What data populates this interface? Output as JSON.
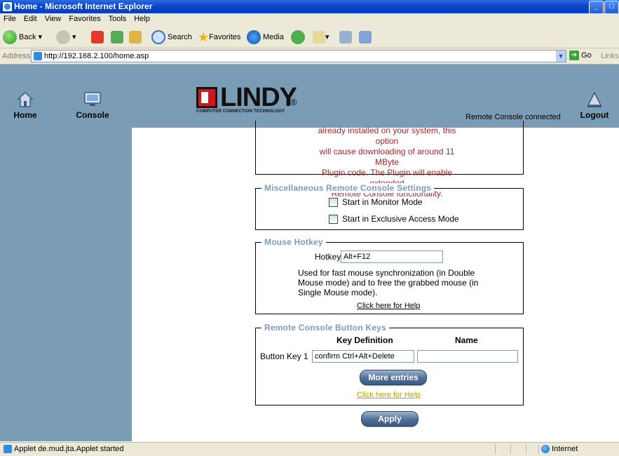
{
  "window": {
    "title": "Home - Microsoft Internet Explorer"
  },
  "menu": [
    "File",
    "Edit",
    "View",
    "Favorites",
    "Tools",
    "Help"
  ],
  "toolbar": {
    "back": "Back",
    "search": "Search",
    "favorites": "Favorites",
    "media": "Media"
  },
  "address": {
    "label": "Address",
    "url": "http://192.168.2.100/home.asp",
    "go": "Go",
    "links": "Links"
  },
  "header": {
    "home_label": "Home",
    "console_label": "Console",
    "logo_text": "LINDY",
    "logo_reg": "®",
    "logo_tagline": "COMPUTER CONNECTION TECHNOLOGY",
    "status": "Remote Console connected",
    "logout_label": "Logout"
  },
  "warning_lines": [
    "already installed on your system, this option",
    "will cause downloading of around 11 MByte",
    "Plugin code. The Plugin will enable extended",
    "Remote Console functionality."
  ],
  "misc": {
    "legend": "Miscellaneous Remote Console Settings",
    "monitor_mode": "Start in Monitor Mode",
    "exclusive_mode": "Start in Exclusive Access Mode"
  },
  "mouse_hotkey": {
    "legend": "Mouse Hotkey",
    "label": "Hotkey",
    "value": "Alt+F12",
    "desc_lines": [
      "Used for fast mouse synchronization (in Double",
      "Mouse mode) and to free the grabbed mouse (in",
      "Single Mouse mode)."
    ],
    "help_link": "Click here for Help"
  },
  "button_keys": {
    "legend": "Remote Console Button Keys",
    "col_key_def": "Key Definition",
    "col_name": "Name",
    "row_label": "Button Key 1",
    "key_value": "confirm Ctrl+Alt+Delete",
    "name_value": "",
    "more_entries": "More entries",
    "help_link": "Click here for Help"
  },
  "apply_label": "Apply",
  "statusbar": {
    "text": "Applet de.mud.jta.Applet started",
    "zone": "Internet"
  },
  "colors": {
    "sidebar": "#7b9cb5",
    "warning": "#a8262c",
    "legend": "#7f9ab8",
    "title_bar": "#0a46c8"
  }
}
